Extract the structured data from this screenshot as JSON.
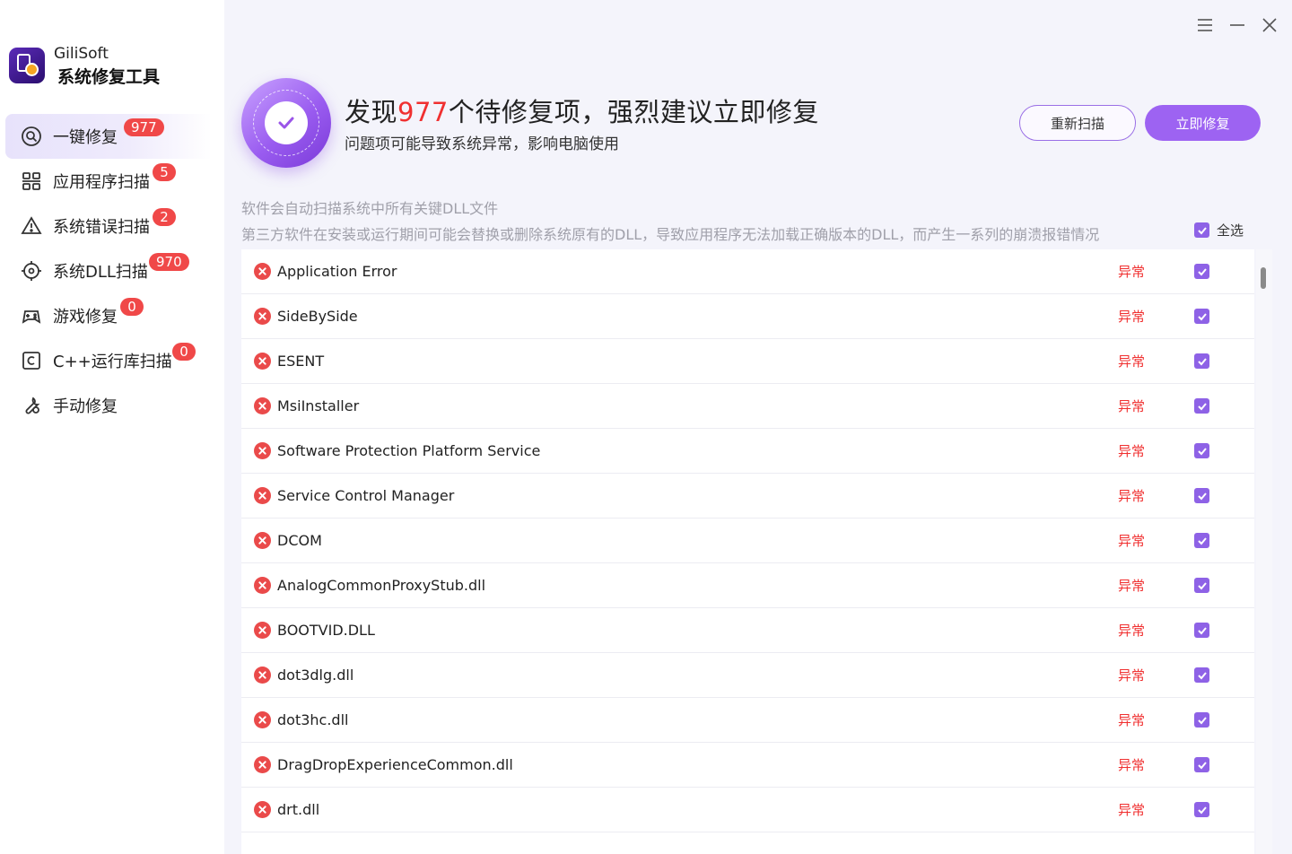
{
  "app": {
    "brand": "GiliSoft",
    "product": "系统修复工具"
  },
  "window_controls": {
    "menu_icon": "menu-icon",
    "minimize_icon": "minimize-icon",
    "close_icon": "close-icon"
  },
  "sidebar": {
    "items": [
      {
        "label": "一键修复",
        "badge": "977",
        "icon": "one-click-repair-icon",
        "active": true
      },
      {
        "label": "应用程序扫描",
        "badge": "5",
        "icon": "app-scan-icon"
      },
      {
        "label": "系统错误扫描",
        "badge": "2",
        "icon": "warning-icon"
      },
      {
        "label": "系统DLL扫描",
        "badge": "970",
        "icon": "target-icon"
      },
      {
        "label": "游戏修复",
        "badge": "0",
        "icon": "gamepad-icon"
      },
      {
        "label": "C++运行库扫描",
        "badge": "0",
        "icon": "c-box-icon"
      },
      {
        "label": "手动修复",
        "icon": "wrench-icon"
      }
    ]
  },
  "header": {
    "headline_pre": "发现",
    "count": "977",
    "headline_post": "个待修复项，强烈建议立即修复",
    "subline": "问题项可能导致系统异常，影响电脑使用",
    "rescan_label": "重新扫描",
    "fix_now_label": "立即修复"
  },
  "description": {
    "line1": "软件会自动扫描系统中所有关键DLL文件",
    "line2": "第三方软件在安装或运行期间可能会替换或删除系统原有的DLL，导致应用程序无法加载正确版本的DLL，而产生一系列的崩溃报错情况",
    "select_all_label": "全选",
    "select_all_checked": true
  },
  "colors": {
    "accent": "#9d63f2",
    "error": "#f03030",
    "badge": "#f04848"
  },
  "issues": [
    {
      "name": "Application Error",
      "status": "异常",
      "checked": true
    },
    {
      "name": "SideBySide",
      "status": "异常",
      "checked": true
    },
    {
      "name": "ESENT",
      "status": "异常",
      "checked": true
    },
    {
      "name": "MsiInstaller",
      "status": "异常",
      "checked": true
    },
    {
      "name": "Software Protection Platform Service",
      "status": "异常",
      "checked": true
    },
    {
      "name": "Service Control Manager",
      "status": "异常",
      "checked": true
    },
    {
      "name": "DCOM",
      "status": "异常",
      "checked": true
    },
    {
      "name": "AnalogCommonProxyStub.dll",
      "status": "异常",
      "checked": true
    },
    {
      "name": "BOOTVID.DLL",
      "status": "异常",
      "checked": true
    },
    {
      "name": "dot3dlg.dll",
      "status": "异常",
      "checked": true
    },
    {
      "name": "dot3hc.dll",
      "status": "异常",
      "checked": true
    },
    {
      "name": "DragDropExperienceCommon.dll",
      "status": "异常",
      "checked": true
    },
    {
      "name": "drt.dll",
      "status": "异常",
      "checked": true
    }
  ]
}
